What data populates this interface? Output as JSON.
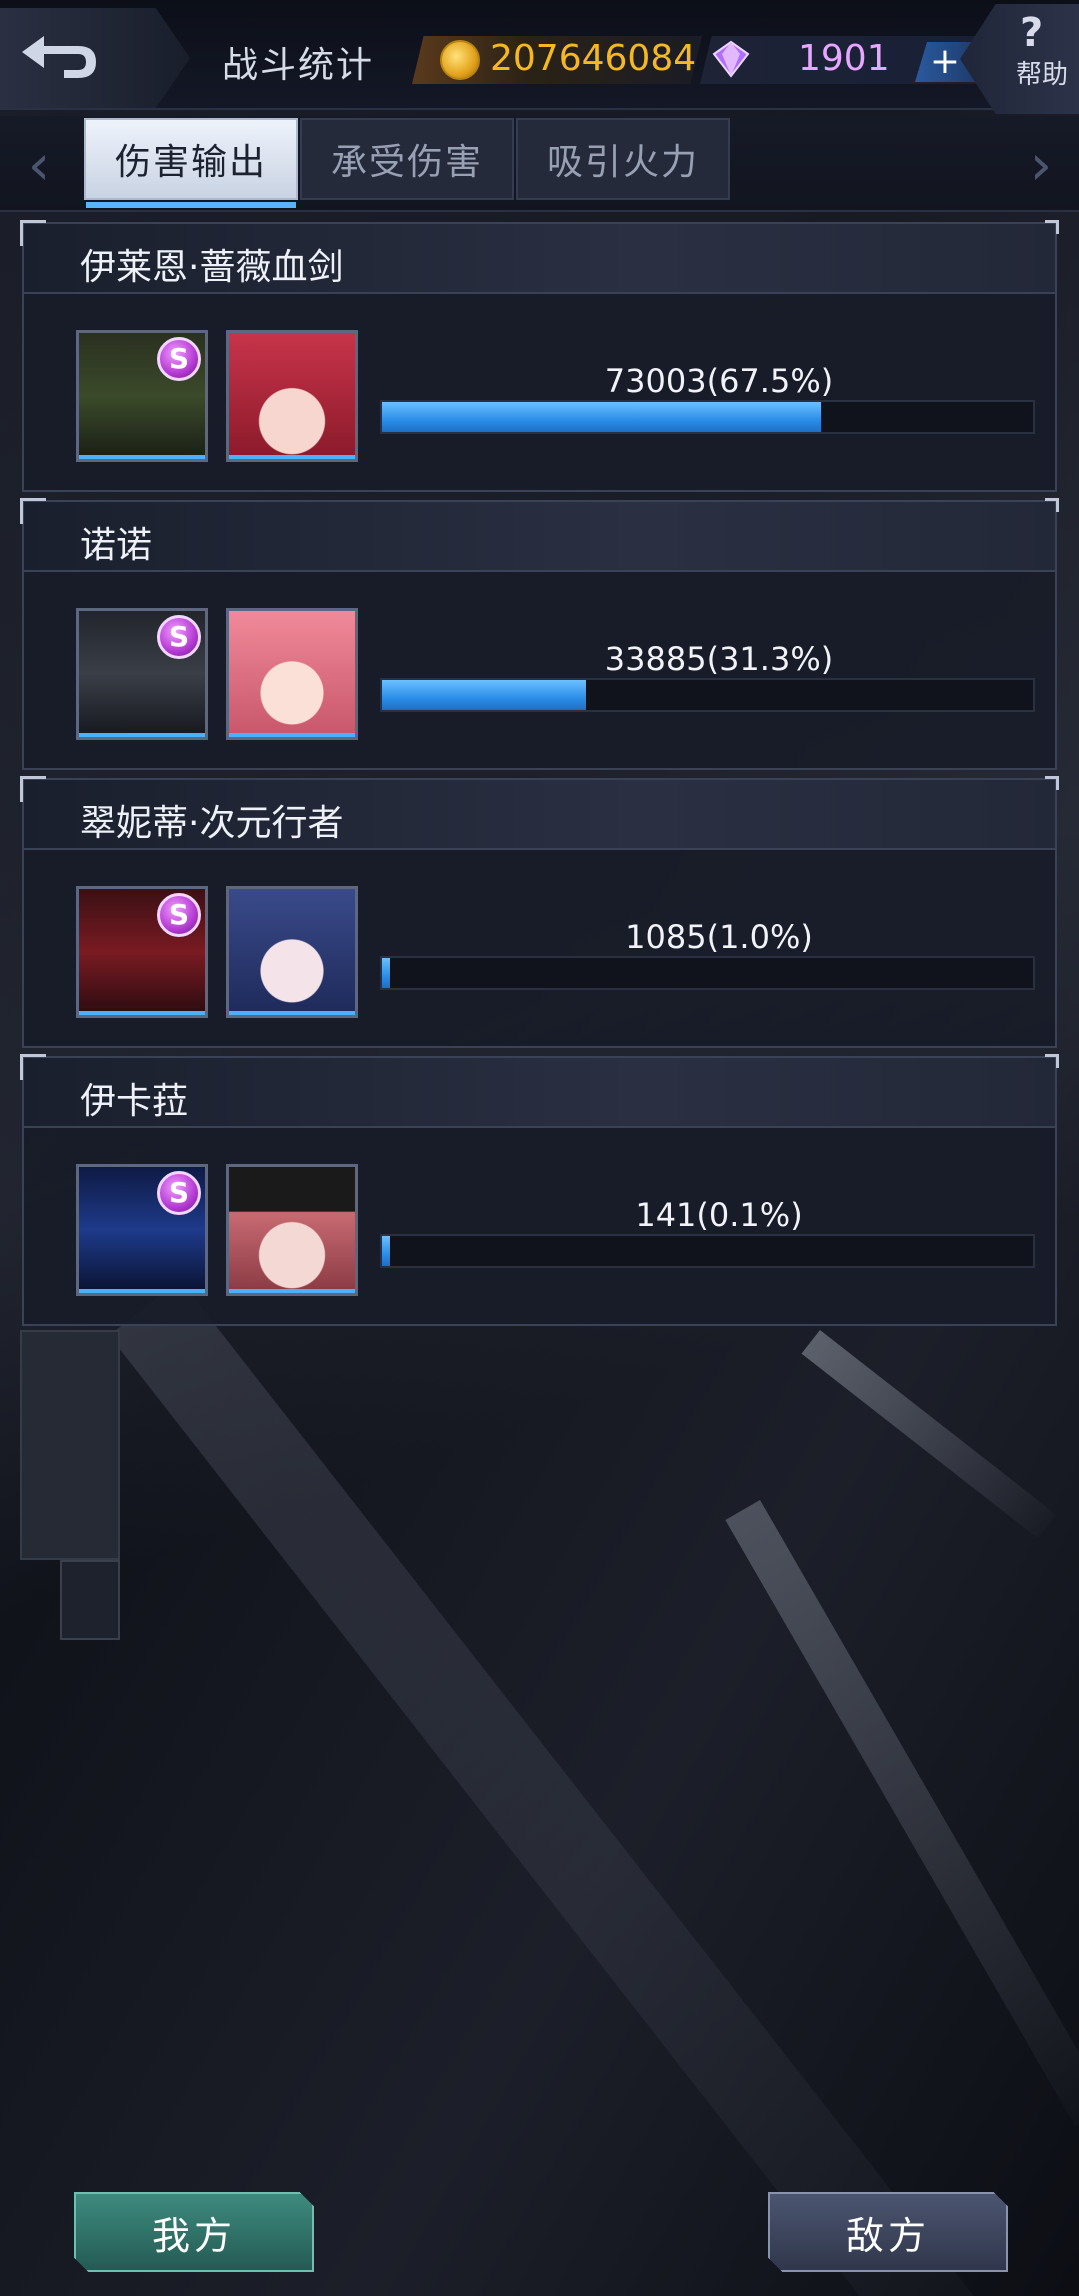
{
  "header": {
    "title": "战斗统计",
    "coins": "207646084",
    "gems": "1901",
    "plus_label": "+",
    "help_label": "帮助",
    "help_symbol": "?"
  },
  "tabs": [
    {
      "label": "伤害输出",
      "active": true
    },
    {
      "label": "承受伤害",
      "active": false
    },
    {
      "label": "吸引火力",
      "active": false
    }
  ],
  "nav": {
    "left_arrow": "‹",
    "right_arrow": "›"
  },
  "entries": [
    {
      "name": "伊莱恩·蔷薇血剑",
      "value_text": "73003(67.5%)",
      "fraction": 0.675,
      "mech_color": "#3b4a2a",
      "girl_hair": "#c8344a"
    },
    {
      "name": "诺诺",
      "value_text": "33885(31.3%)",
      "fraction": 0.313,
      "mech_color": "#3a3e46",
      "girl_hair": "#e67a8c"
    },
    {
      "name": "翠妮蒂·次元行者",
      "value_text": "1085(1.0%)",
      "fraction": 0.01,
      "mech_color": "#7a1a22",
      "girl_hair": "#3a4a8a"
    },
    {
      "name": "伊卡菈",
      "value_text": "141(0.1%)",
      "fraction": 0.001,
      "mech_color": "#1e3a8a",
      "girl_hair": "#c86a72"
    }
  ],
  "badge_letter": "S",
  "buttons": {
    "ours": "我方",
    "enemy": "敌方"
  },
  "colors": {
    "accent": "#4ab0ff",
    "coin": "#f5b823",
    "gem": "#e7a6ff",
    "ours_btn": "#3e8a7e",
    "enemy_btn": "#4c5570"
  }
}
